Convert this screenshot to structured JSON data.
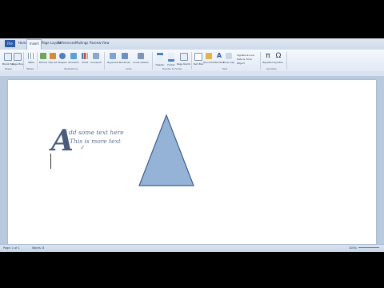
{
  "tabs": [
    "File",
    "Home",
    "Insert",
    "Page Layout",
    "References",
    "Mailings",
    "Review",
    "View"
  ],
  "ribbon": {
    "buttons": [
      "Blank Page",
      "Page Break",
      "Table",
      "Picture",
      "Clip Art",
      "Shapes",
      "SmartArt",
      "Chart",
      "Screenshot",
      "Hyperlink",
      "Bookmark",
      "Cross-reference",
      "Header",
      "Footer",
      "Page Number",
      "Text Box",
      "Quick Parts",
      "WordArt",
      "Drop Cap",
      "Equation",
      "Symbol"
    ],
    "small_items": [
      "Signature Line",
      "Date & Time",
      "Object"
    ],
    "groups": [
      "Pages",
      "Tables",
      "Illustrations",
      "Links",
      "Header & Footer",
      "Text",
      "Symbols"
    ]
  },
  "document": {
    "big_letter": "A",
    "line1": "dd some text here",
    "line2": "This is more text",
    "shape_fill": "#95b3d7",
    "shape_stroke": "#3c5f8c"
  },
  "status": {
    "page": "Page: 1 of 1",
    "words": "Words: 8",
    "zoom": "100%"
  }
}
